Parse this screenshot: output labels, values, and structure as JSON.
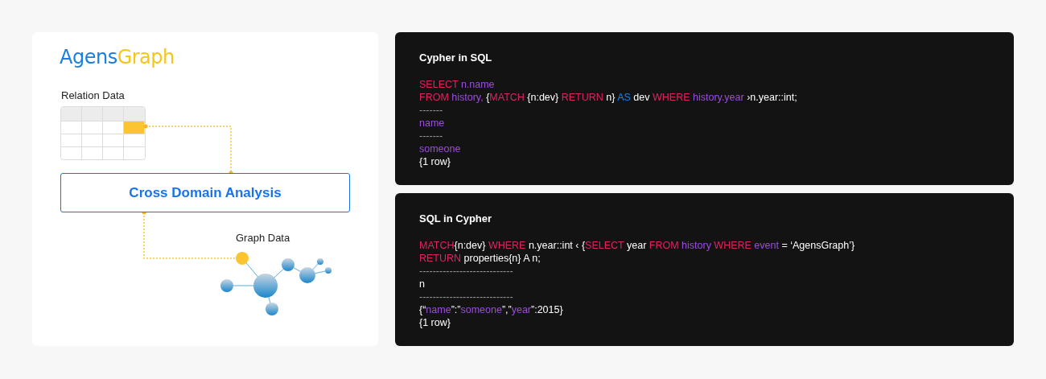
{
  "diagram": {
    "logo": [
      {
        "text": "Agens",
        "color": "#1a7fe0"
      },
      {
        "text": "Graph",
        "color": "#f5c518"
      }
    ],
    "relation_label": "Relation Data",
    "analysis_box": "Cross Domain Analysis",
    "graph_label": "Graph Data"
  },
  "panels": [
    {
      "title": "Cypher in SQL",
      "lines": [
        [
          {
            "kind": "keyword",
            "text": "SELECT "
          },
          {
            "kind": "identifier",
            "text": "n.name"
          }
        ],
        [
          {
            "kind": "keyword",
            "text": "FROM "
          },
          {
            "kind": "identifier",
            "text": "history, "
          },
          {
            "kind": "plain",
            "text": "{"
          },
          {
            "kind": "keyword",
            "text": "MATCH "
          },
          {
            "kind": "plain",
            "text": "{n:dev} "
          },
          {
            "kind": "keyword",
            "text": "RETURN "
          },
          {
            "kind": "plain",
            "text": "n} "
          },
          {
            "kind": "alias",
            "text": "AS "
          },
          {
            "kind": "plain",
            "text": "dev "
          },
          {
            "kind": "keyword",
            "text": "WHERE "
          },
          {
            "kind": "identifier",
            "text": "history.year "
          },
          {
            "kind": "plain",
            "text": "›n.year::int;"
          }
        ],
        [
          {
            "kind": "rule",
            "text": "-------"
          }
        ],
        [
          {
            "kind": "identifier",
            "text": "name"
          }
        ],
        [
          {
            "kind": "rule",
            "text": "-------"
          }
        ],
        [
          {
            "kind": "identifier",
            "text": "someone"
          }
        ],
        [
          {
            "kind": "plain",
            "text": "{1 row}"
          }
        ]
      ]
    },
    {
      "title": "SQL in Cypher",
      "lines": [
        [
          {
            "kind": "keyword",
            "text": "MATCH"
          },
          {
            "kind": "plain",
            "text": "{n:dev} "
          },
          {
            "kind": "keyword",
            "text": "WHERE "
          },
          {
            "kind": "plain",
            "text": "n.year::int ‹ {"
          },
          {
            "kind": "keyword",
            "text": "SELECT "
          },
          {
            "kind": "plain",
            "text": "year "
          },
          {
            "kind": "keyword",
            "text": "FROM "
          },
          {
            "kind": "identifier",
            "text": "history "
          },
          {
            "kind": "keyword",
            "text": "WHERE "
          },
          {
            "kind": "identifier",
            "text": "event "
          },
          {
            "kind": "plain",
            "text": "= ‘AgensGraph’}"
          }
        ],
        [
          {
            "kind": "keyword",
            "text": "RETURN "
          },
          {
            "kind": "plain",
            "text": "properties{n} A n;"
          }
        ],
        [
          {
            "kind": "rule",
            "text": "----------------------------"
          }
        ],
        [
          {
            "kind": "plain",
            "text": "n"
          }
        ],
        [
          {
            "kind": "rule",
            "text": "----------------------------"
          }
        ],
        [
          {
            "kind": "plain",
            "text": "{“"
          },
          {
            "kind": "identifier",
            "text": "name"
          },
          {
            "kind": "plain",
            "text": "”:”"
          },
          {
            "kind": "identifier",
            "text": "someone"
          },
          {
            "kind": "plain",
            "text": "”,”"
          },
          {
            "kind": "identifier",
            "text": "year"
          },
          {
            "kind": "plain",
            "text": "”:2015}"
          }
        ],
        [
          {
            "kind": "plain",
            "text": "{1 row}"
          }
        ]
      ]
    }
  ]
}
